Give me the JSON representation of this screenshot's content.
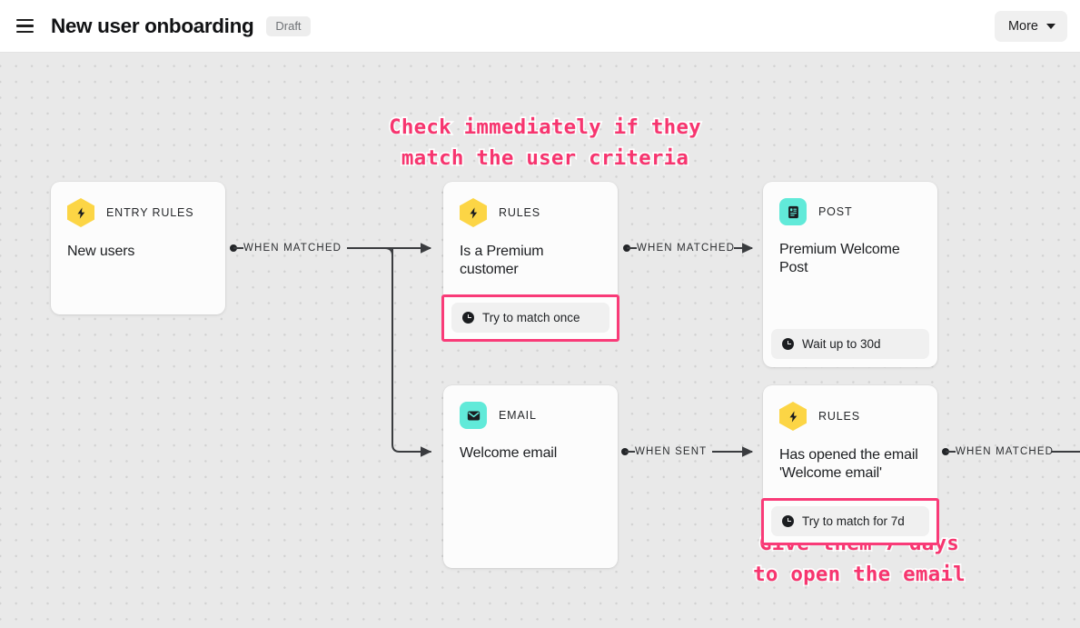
{
  "header": {
    "menu_icon": "hamburger-icon",
    "title": "New user onboarding",
    "status": "Draft",
    "more_label": "More",
    "caret_icon": "chevron-down-icon"
  },
  "canvas": {
    "background_color": "#e9e9e9",
    "dot_color": "#d2d2d2",
    "accent_pink": "#f93b78",
    "yellow": "#fcd545",
    "cyan": "#61ead9"
  },
  "nodes": [
    {
      "id": "entry-rules",
      "kind": "ENTRY RULES",
      "icon": "lightning-bolt-icon",
      "icon_shape": "hexagon",
      "icon_color": "#fcd545",
      "title": "New users",
      "footer": null,
      "footer_highlighted": false
    },
    {
      "id": "rules-premium",
      "kind": "RULES",
      "icon": "lightning-bolt-icon",
      "icon_shape": "hexagon",
      "icon_color": "#fcd545",
      "title": "Is a Premium customer",
      "footer": "Try to match once",
      "footer_icon": "clock-icon",
      "footer_highlighted": true
    },
    {
      "id": "post-premium-welcome",
      "kind": "POST",
      "icon": "document-icon",
      "icon_shape": "square",
      "icon_color": "#61ead9",
      "title": "Premium Welcome Post",
      "footer": "Wait up to 30d",
      "footer_icon": "clock-icon",
      "footer_highlighted": false
    },
    {
      "id": "email-welcome",
      "kind": "EMAIL",
      "icon": "envelope-icon",
      "icon_shape": "square",
      "icon_color": "#61ead9",
      "title": "Welcome email",
      "footer": null,
      "footer_highlighted": false
    },
    {
      "id": "rules-opened-email",
      "kind": "RULES",
      "icon": "lightning-bolt-icon",
      "icon_shape": "hexagon",
      "icon_color": "#fcd545",
      "title": "Has opened the email 'Welcome email'",
      "footer": "Try to match for 7d",
      "footer_icon": "clock-icon",
      "footer_highlighted": true
    }
  ],
  "edges": [
    {
      "id": "edge-entry-to-rules",
      "label": "WHEN MATCHED"
    },
    {
      "id": "edge-rules-to-post",
      "label": "WHEN MATCHED"
    },
    {
      "id": "edge-email-to-rules",
      "label": "WHEN SENT"
    },
    {
      "id": "edge-rules2-out",
      "label": "WHEN MATCHED"
    }
  ],
  "annotations": [
    {
      "id": "annotation-check-immediately",
      "text": "Check immediately if they\nmatch the user criteria",
      "color": "#f7356f"
    },
    {
      "id": "annotation-give-7-days",
      "text": "Give them 7 days\nto open the email",
      "color": "#f7356f"
    }
  ]
}
